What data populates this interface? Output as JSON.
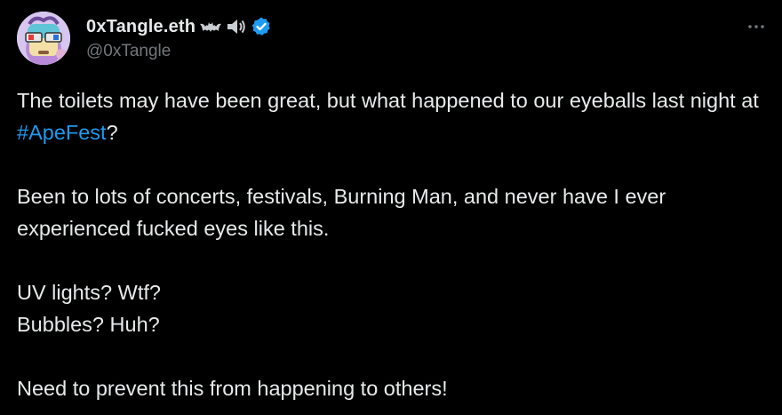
{
  "author": {
    "display_name": "0xTangle.eth",
    "handle": "@0xTangle",
    "verified": true,
    "name_emojis": [
      "bat-icon",
      "speaker-icon"
    ],
    "verified_color": "#1d9bf0"
  },
  "menu": {
    "more_label": "···"
  },
  "tweet": {
    "para1_before": "The toilets may have been great, but what happened to our eyeballs last night at ",
    "hashtag": "#ApeFest",
    "para1_after": "?",
    "para2": "Been to lots of concerts, festivals, Burning Man, and never have I ever experienced fucked eyes like this.",
    "para3_line1": "UV lights? Wtf?",
    "para3_line2": "Bubbles? Huh?",
    "para4": "Need to prevent this from happening to others!"
  },
  "colors": {
    "background": "#000000",
    "text": "#e7e9ea",
    "muted": "#71767b",
    "link": "#1d9bf0"
  }
}
